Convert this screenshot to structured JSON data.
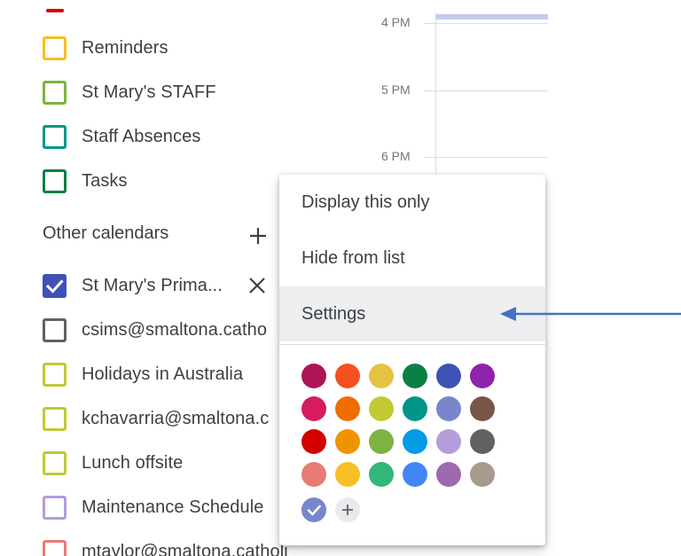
{
  "my_calendars": [
    {
      "label": "Reminders",
      "color": "#F6BF26",
      "checked": false
    },
    {
      "label": "St Mary's STAFF",
      "color": "#7CB342",
      "checked": false
    },
    {
      "label": "Staff Absences",
      "color": "#009688",
      "checked": false
    },
    {
      "label": "Tasks",
      "color": "#0B8043",
      "checked": false
    }
  ],
  "other_calendars": {
    "title": "Other calendars",
    "items": [
      {
        "label": "St Mary's Prima...",
        "color": "#3F51B5",
        "checked": true
      },
      {
        "label": "csims@smaltona.catho",
        "color": "#616161",
        "checked": false
      },
      {
        "label": "Holidays in Australia",
        "color": "#C0CA33",
        "checked": false
      },
      {
        "label": "kchavarria@smaltona.c",
        "color": "#C0CA33",
        "checked": false
      },
      {
        "label": "Lunch offsite",
        "color": "#C0CA33",
        "checked": false
      },
      {
        "label": "Maintenance Schedule",
        "color": "#B39DDB",
        "checked": false
      },
      {
        "label": "mtaylor@smaltona.catholi",
        "color": "#E67C73",
        "checked": false
      }
    ]
  },
  "time_grid": {
    "labels": [
      "4 PM",
      "5 PM",
      "6 PM"
    ],
    "event_color": "#C5CBEE"
  },
  "context_menu": {
    "items": [
      {
        "label": "Display this only"
      },
      {
        "label": "Hide from list"
      },
      {
        "label": "Settings"
      }
    ],
    "palette": [
      [
        "#AD1457",
        "#F4511E",
        "#E4C441",
        "#0B8043",
        "#3F51B5",
        "#8E24AA"
      ],
      [
        "#D81B60",
        "#EF6C00",
        "#C0CA33",
        "#009688",
        "#7986CB",
        "#795548"
      ],
      [
        "#D50000",
        "#F09300",
        "#7CB342",
        "#039BE5",
        "#B39DDB",
        "#616161"
      ],
      [
        "#E67C73",
        "#F6BF26",
        "#33B679",
        "#4285F4",
        "#9E69AF",
        "#A79B8E"
      ]
    ],
    "selected_color": "#7986CB"
  },
  "annotation_arrow_color": "#4472C4"
}
